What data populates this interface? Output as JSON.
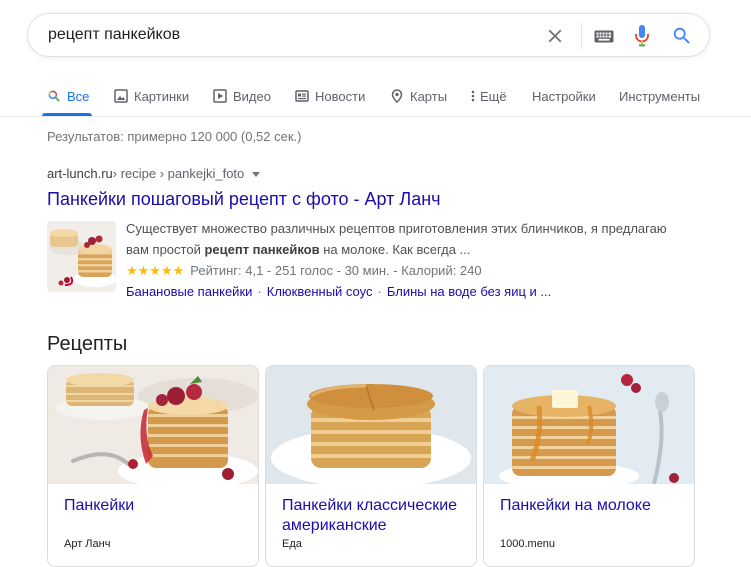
{
  "search": {
    "query": "рецепт панкейков"
  },
  "tabs": [
    {
      "label": "Все",
      "icon": "search-icon"
    },
    {
      "label": "Картинки",
      "icon": "image-icon"
    },
    {
      "label": "Видео",
      "icon": "play-icon"
    },
    {
      "label": "Новости",
      "icon": "newspaper-icon"
    },
    {
      "label": "Карты",
      "icon": "map-pin-icon"
    },
    {
      "label": "Ещё",
      "icon": "more-vert-icon"
    },
    {
      "label": "Настройки"
    },
    {
      "label": "Инструменты"
    }
  ],
  "stats": "Результатов: примерно 120 000 (0,52 сек.)",
  "result": {
    "domain": "art-lunch.ru",
    "path": " › recipe › pankejki_foto",
    "title": "Панкейки пошаговый рецепт с фото - Арт Ланч",
    "snippet_1": "Существует множество различных рецептов приготовления этих блинчиков, я предлагаю вам простой ",
    "snippet_bold": "рецепт панкейков",
    "snippet_2": " на молоке. Как всегда ...",
    "stars": "★★★★★",
    "rating": "Рейтинг: 4,1 - 251 голос - 30 мин. - Калорий: 240",
    "sitelinks": [
      "Банановые панкейки",
      "Клюквенный соус",
      "Блины на воде без яиц и ..."
    ]
  },
  "recipes": {
    "heading": "Рецепты",
    "cards": [
      {
        "title": "Панкейки",
        "source": "Арт Ланч"
      },
      {
        "title": "Панкейки классические американские",
        "source": "Еда"
      },
      {
        "title": "Панкейки на молоке",
        "source": "1000.menu"
      }
    ]
  },
  "colors": {
    "link": "#1a0dab",
    "accent": "#1a73e8",
    "star": "#fbbc04"
  }
}
